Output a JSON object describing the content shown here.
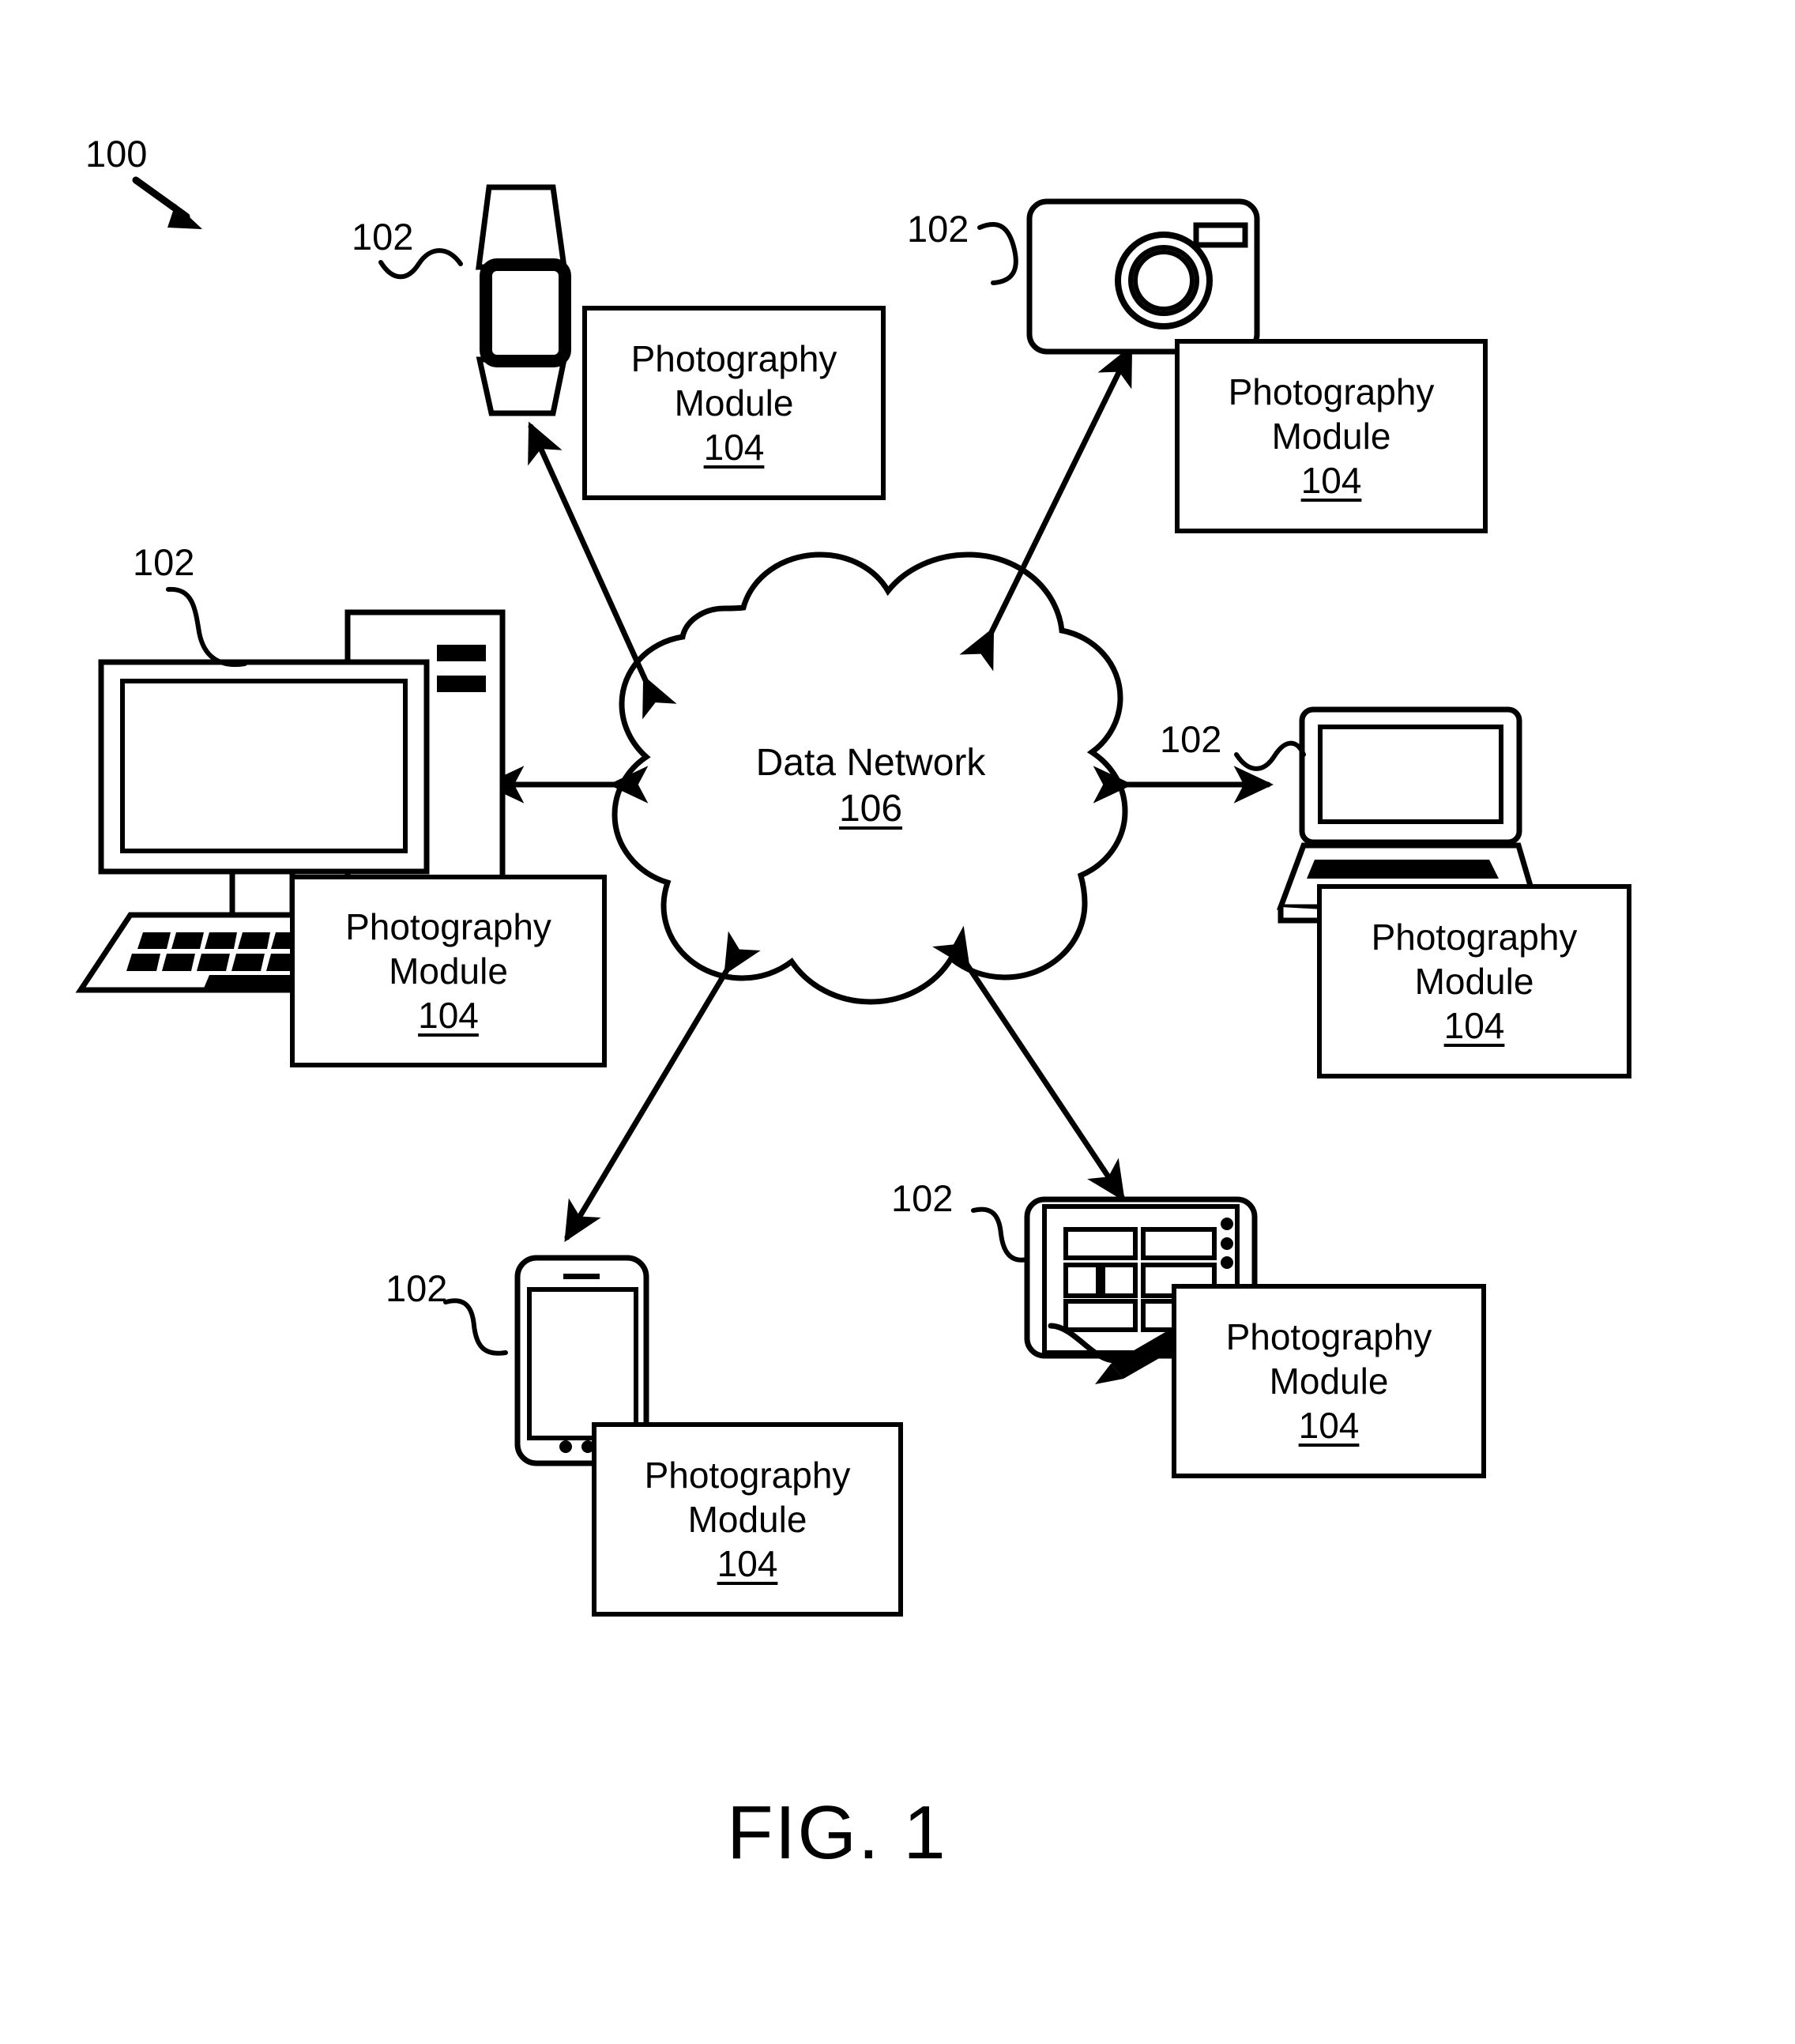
{
  "figure": {
    "caption": "FIG. 1",
    "system_ref": "100"
  },
  "network": {
    "name": "Data Network",
    "ref": "106"
  },
  "module": {
    "line1": "Photography",
    "line2": "Module",
    "ref": "104"
  },
  "device_ref": "102",
  "devices": [
    {
      "id": "smartwatch",
      "name": "smartwatch",
      "ref": "102",
      "module": {
        "line1": "Photography",
        "line2": "Module",
        "ref": "104"
      }
    },
    {
      "id": "digital-camera",
      "name": "digital camera",
      "ref": "102",
      "module": {
        "line1": "Photography",
        "line2": "Module",
        "ref": "104"
      }
    },
    {
      "id": "desktop-computer",
      "name": "desktop computer",
      "ref": "102",
      "module": {
        "line1": "Photography",
        "line2": "Module",
        "ref": "104"
      }
    },
    {
      "id": "laptop-computer",
      "name": "laptop computer",
      "ref": "102",
      "module": {
        "line1": "Photography",
        "line2": "Module",
        "ref": "104"
      }
    },
    {
      "id": "smartphone",
      "name": "smartphone",
      "ref": "102",
      "module": {
        "line1": "Photography",
        "line2": "Module",
        "ref": "104"
      }
    },
    {
      "id": "tablet",
      "name": "tablet with stylus",
      "ref": "102",
      "module": {
        "line1": "Photography",
        "line2": "Module",
        "ref": "104"
      }
    }
  ],
  "colors": {
    "ink": "#000000",
    "background": "#ffffff"
  }
}
